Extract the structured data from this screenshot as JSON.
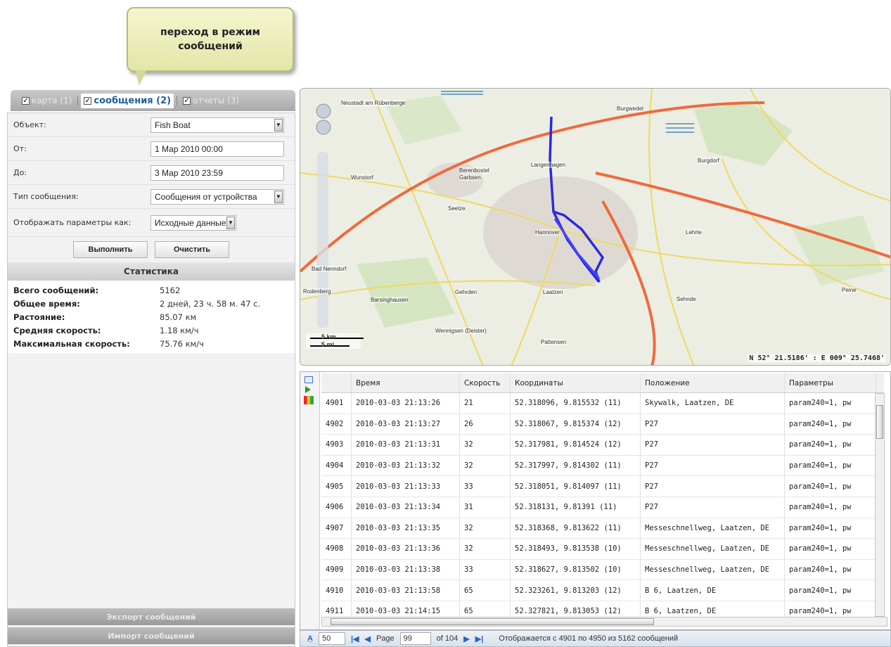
{
  "callout": {
    "text": "переход в режим сообщений"
  },
  "tabs": [
    {
      "label": "карта (1)",
      "checked": true,
      "active": false
    },
    {
      "label": "сообщения (2)",
      "checked": true,
      "active": true
    },
    {
      "label": "отчеты (3)",
      "checked": true,
      "active": false
    }
  ],
  "form": {
    "object_label": "Объект:",
    "object_value": "Fish Boat",
    "from_label": "От:",
    "from_value": "1 Мар 2010 00:00",
    "to_label": "До:",
    "to_value": "3 Мар 2010 23:59",
    "msgtype_label": "Тип сообщения:",
    "msgtype_value": "Сообщения от устройства",
    "display_label": "Отображать параметры как:",
    "display_value": "Исходные данные",
    "execute_label": "Выполнить",
    "clear_label": "Очистить"
  },
  "stats": {
    "title": "Статистика",
    "rows": [
      {
        "label": "Всего сообщений:",
        "value": "5162"
      },
      {
        "label": "Общее время:",
        "value": "2 дней, 23 ч. 58 м. 47 с."
      },
      {
        "label": "Растояние:",
        "value": "85.07 км"
      },
      {
        "label": "Средняя скорость:",
        "value": "1.18 км/ч"
      },
      {
        "label": "Максимальная скорость:",
        "value": "75.76 км/ч"
      }
    ]
  },
  "bottom": {
    "export_label": "Экспорт сообщений",
    "import_label": "Импорт сообщений"
  },
  "map": {
    "labels": [
      "Neustadt am Rübenberge",
      "Burgwedel",
      "Langenhagen",
      "Burgdorf",
      "Berenbostel",
      "Garbsen",
      "Wunstorf",
      "Seelze",
      "Hannover",
      "Lehrte",
      "Barsinghausen",
      "Gehrden",
      "Laatzen",
      "Sehnde",
      "Peine",
      "Wennigsen (Deister)",
      "Pattensen",
      "Bad Nenndorf",
      "Rodenberg"
    ],
    "scale_km": "5 km",
    "scale_mi": "5 mi",
    "coords": "N 52° 21.5186' : E 009° 25.7468'",
    "track_color": "#2a2ae0"
  },
  "grid": {
    "headers": [
      "",
      "Время",
      "Скорость",
      "Координаты",
      "Положение",
      "Параметры"
    ],
    "rows": [
      [
        "4901",
        "2010-03-03 21:13:26",
        "21",
        "52.318096, 9.815532 (11)",
        "Skywalk, Laatzen, DE",
        "param240=1, pw"
      ],
      [
        "4902",
        "2010-03-03 21:13:27",
        "26",
        "52.318067, 9.815374 (12)",
        "P27",
        "param240=1, pw"
      ],
      [
        "4903",
        "2010-03-03 21:13:31",
        "32",
        "52.317981, 9.814524 (12)",
        "P27",
        "param240=1, pw"
      ],
      [
        "4904",
        "2010-03-03 21:13:32",
        "32",
        "52.317997, 9.814302 (11)",
        "P27",
        "param240=1, pw"
      ],
      [
        "4905",
        "2010-03-03 21:13:33",
        "33",
        "52.318051, 9.814097 (11)",
        "P27",
        "param240=1, pw"
      ],
      [
        "4906",
        "2010-03-03 21:13:34",
        "31",
        "52.318131, 9.81391 (11)",
        "P27",
        "param240=1, pw"
      ],
      [
        "4907",
        "2010-03-03 21:13:35",
        "32",
        "52.318368, 9.813622 (11)",
        "Messeschnellweg, Laatzen, DE",
        "param240=1, pw"
      ],
      [
        "4908",
        "2010-03-03 21:13:36",
        "32",
        "52.318493, 9.813538 (10)",
        "Messeschnellweg, Laatzen, DE",
        "param240=1, pw"
      ],
      [
        "4909",
        "2010-03-03 21:13:38",
        "33",
        "52.318627, 9.813502 (10)",
        "Messeschnellweg, Laatzen, DE",
        "param240=1, pw"
      ],
      [
        "4910",
        "2010-03-03 21:13:58",
        "65",
        "52.323261, 9.813203 (12)",
        "B 6, Laatzen, DE",
        "param240=1, pw"
      ],
      [
        "4911",
        "2010-03-03 21:14:15",
        "65",
        "52.327821, 9.813053 (12)",
        "B 6, Laatzen, DE",
        "param240=1, pw"
      ]
    ]
  },
  "pager": {
    "page_size": "50",
    "page_label": "Page",
    "page_value": "99",
    "of_label": "of 104",
    "summary": "Отображается с 4901 по 4950 из 5162 сообщений"
  }
}
